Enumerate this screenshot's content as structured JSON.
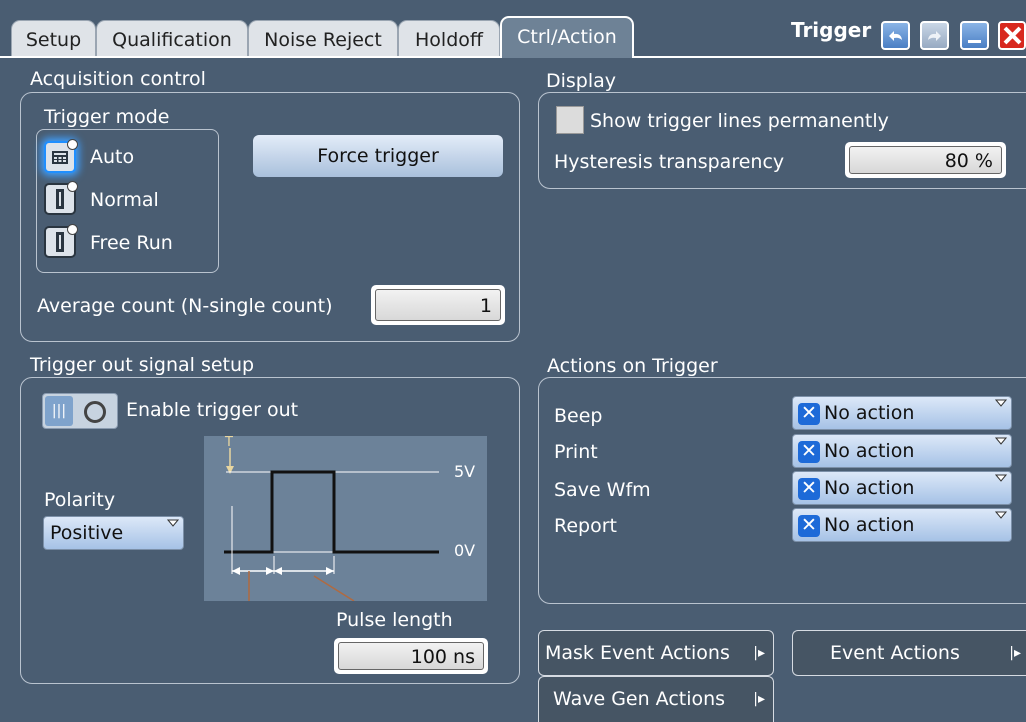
{
  "tabs": [
    "Setup",
    "Qualification",
    "Noise Reject",
    "Holdoff",
    "Ctrl/Action"
  ],
  "window": {
    "title": "Trigger"
  },
  "acquisition": {
    "title": "Acquisition control",
    "trigger_mode_title": "Trigger mode",
    "modes": [
      "Auto",
      "Normal",
      "Free Run"
    ],
    "force_trigger": "Force trigger",
    "average_count_label": "Average count (N-single count)",
    "average_count_value": "1"
  },
  "display": {
    "title": "Display",
    "show_lines": "Show trigger lines permanently",
    "hysteresis_label": "Hysteresis transparency",
    "hysteresis_value": "80 %"
  },
  "trigger_out": {
    "title": "Trigger out signal setup",
    "enable_label": "Enable trigger out",
    "polarity_label": "Polarity",
    "polarity_value": "Positive",
    "diagram_t": "T",
    "diagram_high": "5V",
    "diagram_low": "0V",
    "pulse_length_label": "Pulse length",
    "pulse_length_value": "100 ns"
  },
  "actions": {
    "title": "Actions on Trigger",
    "rows": [
      {
        "label": "Beep",
        "value": "No action"
      },
      {
        "label": "Print",
        "value": "No action"
      },
      {
        "label": "Save Wfm",
        "value": "No action"
      },
      {
        "label": "Report",
        "value": "No action"
      }
    ]
  },
  "buttons": {
    "mask_event": "Mask Event Actions",
    "event": "Event Actions",
    "wave_gen": "Wave Gen Actions"
  }
}
